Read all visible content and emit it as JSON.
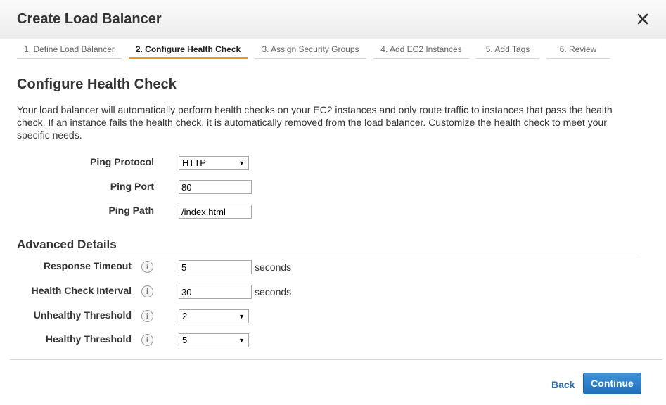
{
  "dialog": {
    "title": "Create Load Balancer",
    "close_icon": "close-icon"
  },
  "tabs": [
    {
      "label": "1. Define Load Balancer"
    },
    {
      "label": "2. Configure Health Check",
      "active": true
    },
    {
      "label": "3. Assign Security Groups"
    },
    {
      "label": "4. Add EC2 Instances"
    },
    {
      "label": "5. Add Tags"
    },
    {
      "label": "6. Review"
    }
  ],
  "main": {
    "heading": "Configure Health Check",
    "description": "Your load balancer will automatically perform health checks on your EC2 instances and only route traffic to instances that pass the health check. If an instance fails the health check, it is automatically removed from the load balancer. Customize the health check to meet your specific needs."
  },
  "form": {
    "ping_protocol": {
      "label": "Ping Protocol",
      "value": "HTTP"
    },
    "ping_port": {
      "label": "Ping Port",
      "value": "80"
    },
    "ping_path": {
      "label": "Ping Path",
      "value": "/index.html"
    }
  },
  "advanced": {
    "heading": "Advanced Details",
    "info_glyph": "i",
    "response_timeout": {
      "label": "Response Timeout",
      "value": "5",
      "unit": "seconds"
    },
    "health_check_interval": {
      "label": "Health Check Interval",
      "value": "30",
      "unit": "seconds"
    },
    "unhealthy_threshold": {
      "label": "Unhealthy Threshold",
      "value": "2"
    },
    "healthy_threshold": {
      "label": "Healthy Threshold",
      "value": "5"
    }
  },
  "footer": {
    "back_label": "Back",
    "continue_label": "Continue"
  },
  "colors": {
    "accent_tab": "#f29b20",
    "primary_button": "#1f6fb8",
    "link": "#2a6fb8"
  }
}
